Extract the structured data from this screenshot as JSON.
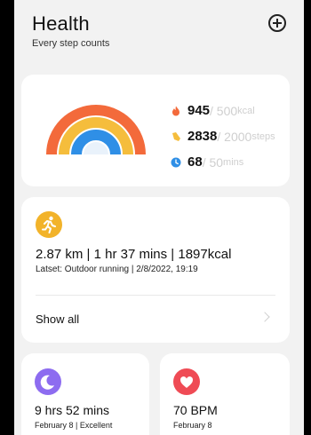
{
  "header": {
    "title": "Health",
    "subtitle": "Every step counts"
  },
  "rings": {
    "colors": {
      "outer": "#f36a3b",
      "middle": "#f5bd3c",
      "inner": "#2f8fe6"
    }
  },
  "stats": [
    {
      "icon": "flame-icon",
      "color": "#f36a3b",
      "current": "945",
      "goal": "/ 500",
      "unit": "kcal"
    },
    {
      "icon": "steps-icon",
      "color": "#f5bd3c",
      "current": "2838",
      "goal": "/ 2000",
      "unit": "steps"
    },
    {
      "icon": "clock-icon",
      "color": "#2f8fe6",
      "current": "68",
      "goal": "/ 50",
      "unit": "mins"
    }
  ],
  "activity": {
    "summary": "2.87 km | 1 hr 37 mins | 1897kcal",
    "latest": "Latset:  Outdoor running | 2/8/2022, 19:19",
    "show_all": "Show all"
  },
  "sleep": {
    "value": "9 hrs 52 mins",
    "detail": "February 8 | Excellent",
    "color": "#8d6cf0"
  },
  "heart": {
    "value": "70 BPM",
    "detail": "February 8",
    "color": "#ef4b55"
  }
}
